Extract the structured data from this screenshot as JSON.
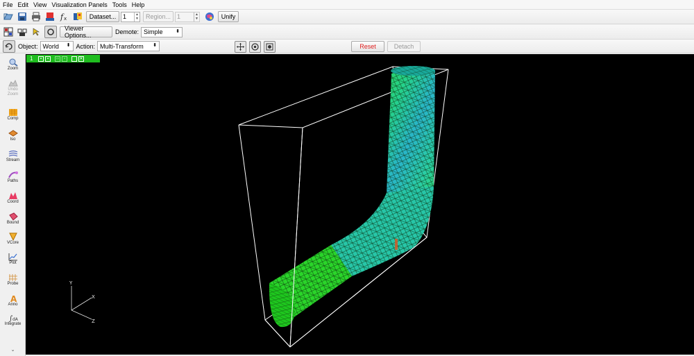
{
  "menu": [
    "File",
    "Edit",
    "View",
    "Visualization Panels",
    "Tools",
    "Help"
  ],
  "toolbar1": {
    "dataset_button": "Dataset...",
    "dataset_value": "1",
    "region_button": "Region...",
    "region_value": "1",
    "unify_button": "Unify"
  },
  "toolbar2": {
    "viewer_options_button": "Viewer Options...",
    "demote_label": "Demote:",
    "demote_value": "Simple"
  },
  "toolbar3": {
    "object_label": "Object:",
    "object_value": "World",
    "action_label": "Action:",
    "action_value": "Multi-Transform",
    "reset_button": "Reset",
    "detach_button": "Detach"
  },
  "sidebar": [
    {
      "label": "Zoom",
      "icon": "zoom-icon"
    },
    {
      "label": "Undo Zoom",
      "icon": "undo-zoom-icon",
      "disabled": true
    },
    {
      "label": "Comp",
      "icon": "comp-icon"
    },
    {
      "label": "Iso",
      "icon": "iso-icon"
    },
    {
      "label": "Stream",
      "icon": "stream-icon"
    },
    {
      "label": "Paths",
      "icon": "paths-icon"
    },
    {
      "label": "Coord",
      "icon": "coord-icon"
    },
    {
      "label": "Bound",
      "icon": "bound-icon"
    },
    {
      "label": "VCore",
      "icon": "vcore-icon"
    },
    {
      "label": "Plot",
      "icon": "plot-icon"
    },
    {
      "label": "Probe",
      "icon": "probe-icon"
    },
    {
      "label": "Anno",
      "icon": "anno-icon"
    },
    {
      "label": "Integrate",
      "icon": "integrate-icon"
    }
  ],
  "viewport": {
    "tab_number": "1",
    "axis_labels": {
      "x": "X",
      "y": "Y",
      "z": "Z"
    }
  },
  "colors": {
    "reset_text": "#e02020",
    "viewport_bg": "#000000",
    "tab_green": "#1fbd1f",
    "mesh_green": "#2ad52a",
    "mesh_cyan": "#29b5c8"
  }
}
